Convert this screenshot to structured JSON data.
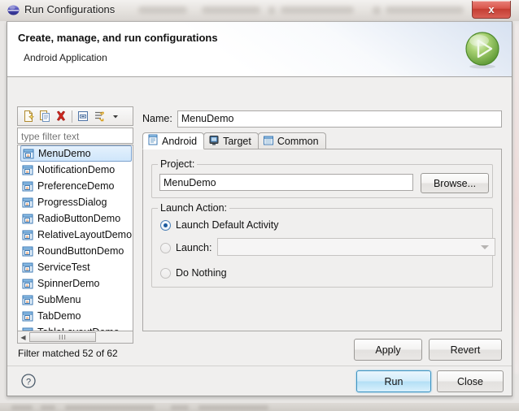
{
  "window": {
    "title": "Run Configurations",
    "icon": "eclipse-sphere-icon",
    "close_label": "x"
  },
  "header": {
    "title": "Create, manage, and run configurations",
    "subtitle": "Android Application",
    "icon": "green-run-circle-icon"
  },
  "left_panel": {
    "toolbar": [
      {
        "name": "new-configuration-icon",
        "tip": "New launch configuration"
      },
      {
        "name": "duplicate-configuration-icon",
        "tip": "Duplicate"
      },
      {
        "name": "delete-configuration-icon",
        "tip": "Delete"
      },
      {
        "name": "collapse-all-icon",
        "tip": "Collapse All"
      },
      {
        "name": "filter-icon",
        "tip": "Filter"
      },
      {
        "name": "view-menu-chevron-down-icon",
        "tip": "View Menu"
      }
    ],
    "filter": {
      "value": "",
      "placeholder": "type filter text"
    },
    "tree_items": [
      {
        "label": "MenuDemo",
        "selected": true
      },
      {
        "label": "NotificationDemo",
        "selected": false
      },
      {
        "label": "PreferenceDemo",
        "selected": false
      },
      {
        "label": "ProgressDialog",
        "selected": false
      },
      {
        "label": "RadioButtonDemo",
        "selected": false
      },
      {
        "label": "RelativeLayoutDemo",
        "selected": false
      },
      {
        "label": "RoundButtonDemo",
        "selected": false
      },
      {
        "label": "ServiceTest",
        "selected": false
      },
      {
        "label": "SpinnerDemo",
        "selected": false
      },
      {
        "label": "SubMenu",
        "selected": false
      },
      {
        "label": "TabDemo",
        "selected": false
      },
      {
        "label": "TableLayoutDemo",
        "selected": false
      }
    ],
    "scroll_thumb_glyph": "III",
    "status": "Filter matched 52 of 62"
  },
  "right_panel": {
    "name_label": "Name:",
    "name_value": "MenuDemo",
    "tabs": [
      {
        "label": "Android",
        "icon": "android-doc-icon",
        "active": true
      },
      {
        "label": "Target",
        "icon": "target-device-icon",
        "active": false
      },
      {
        "label": "Common",
        "icon": "common-list-icon",
        "active": false
      }
    ],
    "project_group": {
      "title": "Project:",
      "value": "MenuDemo",
      "browse_label": "Browse..."
    },
    "launch_group": {
      "title": "Launch Action:",
      "options": [
        {
          "label": "Launch Default Activity",
          "selected": true,
          "enabled": true
        },
        {
          "label": "Launch:",
          "selected": false,
          "enabled": true
        },
        {
          "label": "Do Nothing",
          "selected": false,
          "enabled": true
        }
      ],
      "combo_value": "",
      "combo_enabled": false
    },
    "apply_label": "Apply",
    "revert_label": "Revert"
  },
  "footer": {
    "help_icon": "help-question-icon",
    "run_label": "Run",
    "close_label": "Close"
  },
  "colors": {
    "accent_blue": "#1b5a9e",
    "default_button_border": "#3c93c2",
    "close_button_red": "#c43d32",
    "run_icon_green": "#7ab648",
    "selection_blue": "#cfe6fb"
  }
}
